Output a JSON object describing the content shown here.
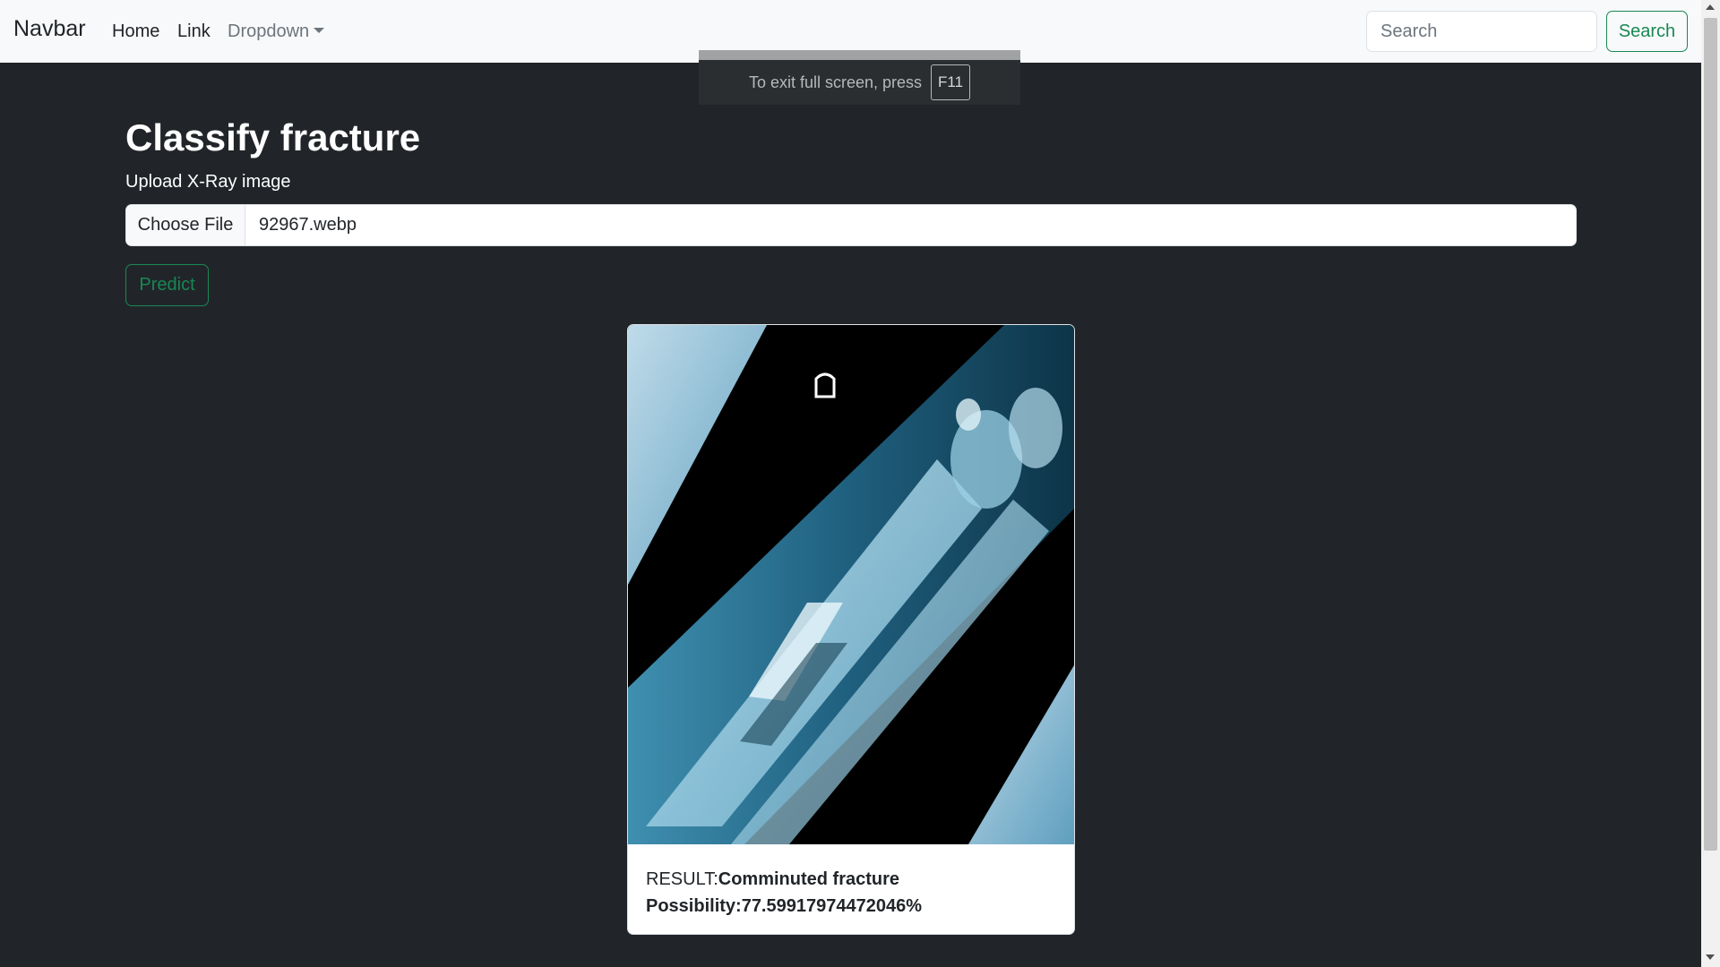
{
  "navbar": {
    "brand": "Navbar",
    "links": [
      "Home",
      "Link"
    ],
    "dropdown_label": "Dropdown",
    "search_placeholder": "Search",
    "search_button": "Search"
  },
  "fullscreen_notice": {
    "text": "To exit full screen, press",
    "key": "F11"
  },
  "main": {
    "title": "Classify fracture",
    "upload_label": "Upload X-Ray image",
    "file_button": "Choose File",
    "file_name": "92967.webp",
    "predict_button": "Predict"
  },
  "result": {
    "result_label": "RESULT:",
    "result_value": "Comminuted fracture",
    "possibility_text": "Possibility:77.59917974472046%"
  },
  "colors": {
    "page_bg": "#212529",
    "navbar_bg": "#f8f9fa",
    "success": "#198754",
    "muted": "#6c757d"
  },
  "icons": [
    "dropdown-caret-icon",
    "scroll-up-icon",
    "scroll-down-icon"
  ]
}
